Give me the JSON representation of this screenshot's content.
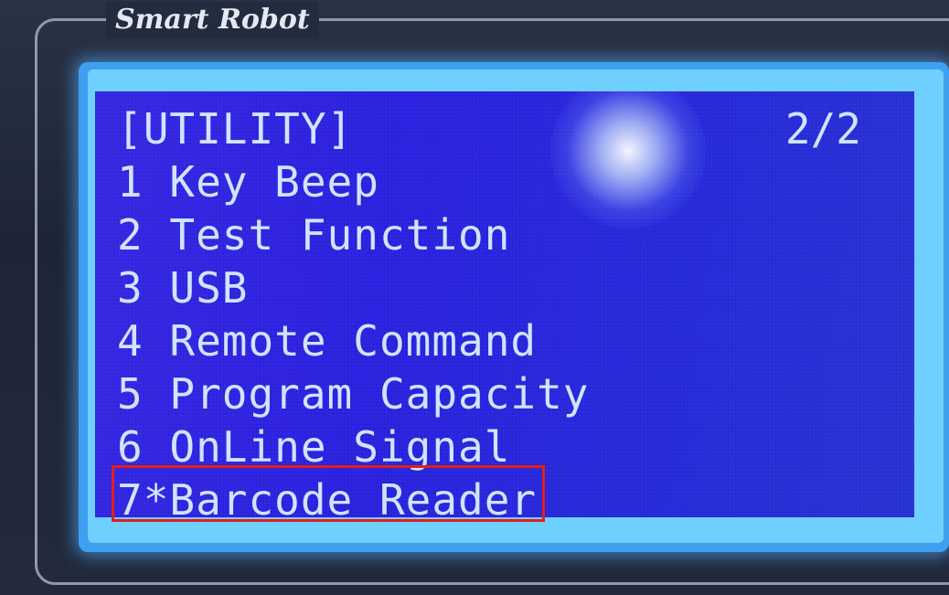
{
  "device": {
    "brand": "Smart Robot"
  },
  "menu": {
    "title": "[UTILITY]",
    "page": "2/2",
    "items": [
      {
        "label": "1 Key Beep"
      },
      {
        "label": "2 Test Function"
      },
      {
        "label": "3 USB"
      },
      {
        "label": "4 Remote Command"
      },
      {
        "label": "5 Program Capacity"
      },
      {
        "label": "6 OnLine Signal"
      },
      {
        "label": "7*Barcode Reader",
        "selected": true
      }
    ]
  },
  "colors": {
    "lcd_background": "#3a2be8",
    "lcd_text": "#cfe4ff",
    "lcd_backlight": "#3fa0f0",
    "highlight_border": "#e0201a"
  }
}
